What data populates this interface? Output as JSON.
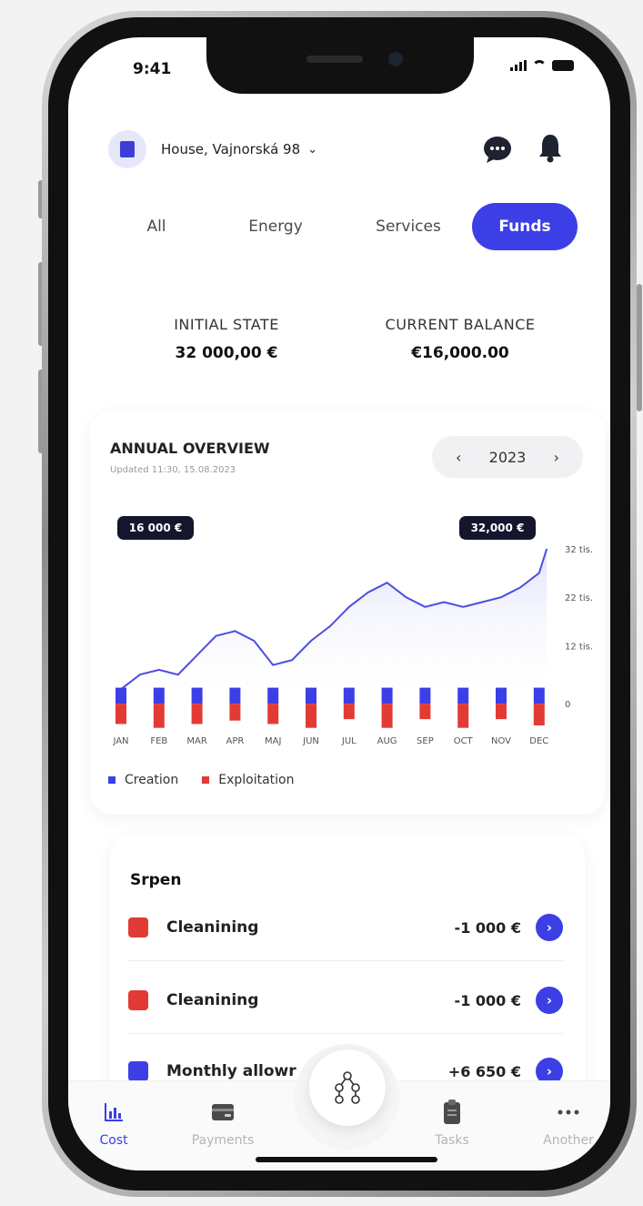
{
  "status_bar": {
    "time": "9:41"
  },
  "header": {
    "property_name": "House, Vajnorská 98"
  },
  "tabs": [
    {
      "label": "All"
    },
    {
      "label": "Energy"
    },
    {
      "label": "Services"
    },
    {
      "label": "Funds",
      "active": true
    }
  ],
  "balance": {
    "initial_label": "INITIAL STATE",
    "initial_value": "32 000,00 €",
    "current_label": "CURRENT BALANCE",
    "current_value": "€16,000.00"
  },
  "overview": {
    "title": "ANNUAL OVERVIEW",
    "updated": "Updated 11:30, 15.08.2023",
    "year": "2023"
  },
  "chart_data": {
    "type": "line+bar",
    "categories": [
      "JAN",
      "FEB",
      "MAR",
      "APR",
      "MAJ",
      "JUN",
      "JUL",
      "AUG",
      "SEP",
      "OCT",
      "NOV",
      "DEC"
    ],
    "line": {
      "x_points": [
        0,
        0.5,
        1,
        1.5,
        2,
        2.5,
        3,
        3.5,
        4,
        4.5,
        5,
        5.5,
        6,
        6.5,
        7,
        7.5,
        8,
        8.5,
        9,
        9.5,
        10,
        10.5,
        11,
        11.2
      ],
      "y_values": [
        3,
        6,
        7,
        6,
        10,
        14,
        15,
        13,
        8,
        9,
        13,
        16,
        20,
        23,
        25,
        22,
        20,
        21,
        20,
        21,
        22,
        24,
        27,
        32
      ]
    },
    "bars": {
      "series": [
        {
          "name": "Creation",
          "values": [
            3.3,
            3.3,
            3.3,
            3.3,
            3.3,
            3.3,
            3.3,
            3.3,
            3.3,
            3.3,
            3.3,
            3.3
          ]
        },
        {
          "name": "Exploitation",
          "values": [
            -4.2,
            -5.0,
            -4.2,
            -3.5,
            -4.2,
            -5.0,
            -3.2,
            -5.0,
            -3.2,
            -5.0,
            -3.2,
            -4.5
          ]
        }
      ]
    },
    "ylim": [
      -6,
      32
    ],
    "y_ticks": [
      {
        "value": 32,
        "label": "32 tis."
      },
      {
        "value": 22,
        "label": "22 tis."
      },
      {
        "value": 12,
        "label": "12 tis."
      },
      {
        "value": 0,
        "label": "0"
      }
    ],
    "annotations": [
      {
        "label": "16 000 €",
        "at": "start"
      },
      {
        "label": "32,000 €",
        "at": "end"
      }
    ],
    "legend": [
      {
        "name": "Creation",
        "color": "#3c3fe6"
      },
      {
        "name": "Exploitation",
        "color": "#e23b36"
      }
    ],
    "colors": {
      "line": "#4a4ee0",
      "creation": "#3c3fe6",
      "exploitation": "#e23b36"
    }
  },
  "transactions": {
    "month": "Srpen",
    "items": [
      {
        "name": "Cleanining",
        "amount": "-1 000 €",
        "type": "Exploitation",
        "color": "#e23b36"
      },
      {
        "name": "Cleanining",
        "amount": "-1 000 €",
        "type": "Exploitation",
        "color": "#e23b36"
      },
      {
        "name": "Monthly allowr",
        "amount": "+6 650 €",
        "type": "Creation",
        "color": "#3c3fe6"
      }
    ]
  },
  "bottom_nav": [
    {
      "label": "Cost",
      "icon": "chart-icon",
      "active": true
    },
    {
      "label": "Payments",
      "icon": "wallet-icon"
    },
    {
      "label": "Tasks",
      "icon": "clipboard-icon"
    },
    {
      "label": "Another",
      "icon": "more-icon"
    }
  ],
  "accent_color": "#3c3fe6"
}
